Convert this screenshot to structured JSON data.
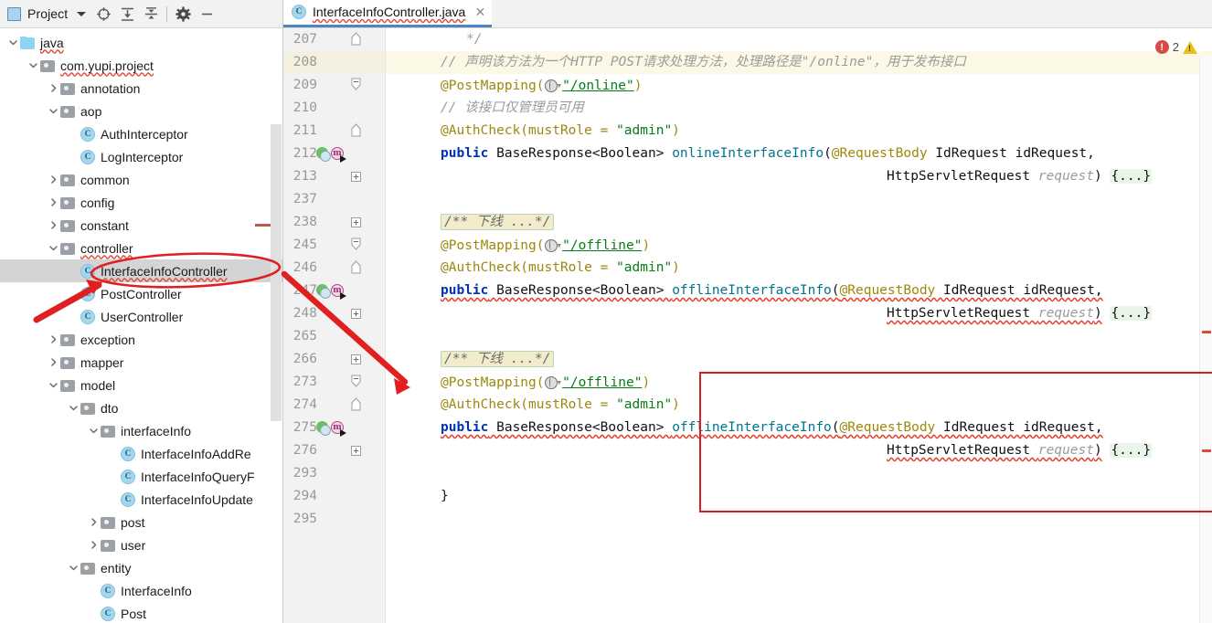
{
  "window": {
    "app": "IntelliJ IDEA",
    "panel_title": "Project"
  },
  "sidebar": {
    "toolbar": {
      "panel_icon": "project-panel-icon",
      "title": "Project",
      "dropdown_caret": "chevron-down-icon",
      "buttons": [
        {
          "name": "locate-icon",
          "tooltip": "Select Opened File"
        },
        {
          "name": "expand-all-icon",
          "tooltip": "Expand All"
        },
        {
          "name": "collapse-all-icon",
          "tooltip": "Collapse All"
        },
        {
          "name": "settings-gear-icon",
          "tooltip": "Settings"
        },
        {
          "name": "minimize-icon",
          "tooltip": "Hide"
        }
      ]
    },
    "tree": [
      {
        "label": "java",
        "type": "source-folder",
        "depth": 0,
        "state": "expanded",
        "squiggly": true
      },
      {
        "label": "com.yupi.project",
        "type": "package",
        "depth": 1,
        "state": "expanded",
        "squiggly": true
      },
      {
        "label": "annotation",
        "type": "package",
        "depth": 2,
        "state": "collapsed",
        "squiggly": false
      },
      {
        "label": "aop",
        "type": "package",
        "depth": 2,
        "state": "expanded",
        "squiggly": false
      },
      {
        "label": "AuthInterceptor",
        "type": "class",
        "depth": 3,
        "state": "leaf",
        "squiggly": false
      },
      {
        "label": "LogInterceptor",
        "type": "class",
        "depth": 3,
        "state": "leaf",
        "squiggly": false
      },
      {
        "label": "common",
        "type": "package",
        "depth": 2,
        "state": "collapsed",
        "squiggly": false
      },
      {
        "label": "config",
        "type": "package",
        "depth": 2,
        "state": "collapsed",
        "squiggly": false
      },
      {
        "label": "constant",
        "type": "package",
        "depth": 2,
        "state": "collapsed",
        "squiggly": false
      },
      {
        "label": "controller",
        "type": "package",
        "depth": 2,
        "state": "expanded",
        "squiggly": true
      },
      {
        "label": "InterfaceInfoController",
        "type": "class",
        "depth": 3,
        "state": "leaf",
        "squiggly": true,
        "selected": true
      },
      {
        "label": "PostController",
        "type": "class",
        "depth": 3,
        "state": "leaf",
        "squiggly": false
      },
      {
        "label": "UserController",
        "type": "class",
        "depth": 3,
        "state": "leaf",
        "squiggly": false
      },
      {
        "label": "exception",
        "type": "package",
        "depth": 2,
        "state": "collapsed",
        "squiggly": false
      },
      {
        "label": "mapper",
        "type": "package",
        "depth": 2,
        "state": "collapsed",
        "squiggly": false
      },
      {
        "label": "model",
        "type": "package",
        "depth": 2,
        "state": "expanded",
        "squiggly": false
      },
      {
        "label": "dto",
        "type": "package",
        "depth": 3,
        "state": "expanded",
        "squiggly": false
      },
      {
        "label": "interfaceInfo",
        "type": "package",
        "depth": 4,
        "state": "expanded",
        "squiggly": false
      },
      {
        "label": "InterfaceInfoAddRe",
        "type": "class",
        "depth": 5,
        "state": "leaf",
        "squiggly": false
      },
      {
        "label": "InterfaceInfoQueryF",
        "type": "class",
        "depth": 5,
        "state": "leaf",
        "squiggly": false
      },
      {
        "label": "InterfaceInfoUpdate",
        "type": "class",
        "depth": 5,
        "state": "leaf",
        "squiggly": false
      },
      {
        "label": "post",
        "type": "package",
        "depth": 4,
        "state": "collapsed",
        "squiggly": false
      },
      {
        "label": "user",
        "type": "package",
        "depth": 4,
        "state": "collapsed",
        "squiggly": false
      },
      {
        "label": "entity",
        "type": "package",
        "depth": 3,
        "state": "expanded",
        "squiggly": false
      },
      {
        "label": "InterfaceInfo",
        "type": "class",
        "depth": 4,
        "state": "leaf",
        "squiggly": false
      },
      {
        "label": "Post",
        "type": "class",
        "depth": 4,
        "state": "leaf",
        "squiggly": false
      }
    ]
  },
  "editor": {
    "tab": {
      "label": "InterfaceInfoController.java",
      "icon": "java-class-icon",
      "close": "✕"
    },
    "inspection": {
      "error_icon": "error-circle-icon",
      "error_count": "2",
      "warning_icon": "warning-triangle-icon"
    },
    "lines": [
      {
        "n": "207",
        "fold": "end",
        "gutter": null,
        "highlight": false,
        "tokens": [
          {
            "t": "cmt_block_end",
            "s": "*/"
          }
        ]
      },
      {
        "n": "208",
        "fold": null,
        "gutter": null,
        "highlight": true,
        "tokens": [
          {
            "t": "cmt",
            "s": "// 声明该方法为一个HTTP POST请求处理方法，处理路径是\"/online\"，用于发布接口"
          }
        ]
      },
      {
        "n": "209",
        "fold": "start",
        "gutter": null,
        "highlight": false,
        "anno": "@PostMapping(",
        "path": "\"/online\"",
        "tail": ")"
      },
      {
        "n": "210",
        "fold": null,
        "gutter": null,
        "highlight": false,
        "tokens": [
          {
            "t": "cmt",
            "s": "// 该接口仅管理员可用"
          }
        ]
      },
      {
        "n": "211",
        "fold": "mid",
        "gutter": null,
        "highlight": false,
        "authcheck": "@AuthCheck(mustRole = ",
        "role": "\"admin\"",
        "tail": ")"
      },
      {
        "n": "212",
        "fold": null,
        "gutter": [
          "web-service-icon",
          "method-override-icon"
        ],
        "highlight": false,
        "sig": "public BaseResponse<Boolean> onlineInterfaceInfo(@RequestBody IdRequest idRequest,"
      },
      {
        "n": "213",
        "fold": "plus",
        "gutter": null,
        "highlight": false,
        "sig2": "HttpServletRequest request) {...}"
      },
      {
        "n": "237",
        "fold": null,
        "gutter": null,
        "highlight": false,
        "tokens": []
      },
      {
        "n": "238",
        "fold": "plus",
        "gutter": null,
        "highlight": false,
        "folded_comment": "/** 下线 ...*/"
      },
      {
        "n": "245",
        "fold": "start",
        "gutter": null,
        "highlight": false,
        "anno": "@PostMapping(",
        "path": "\"/offline\"",
        "tail": ")"
      },
      {
        "n": "246",
        "fold": "mid",
        "gutter": null,
        "highlight": false,
        "authcheck": "@AuthCheck(mustRole = ",
        "role": "\"admin\"",
        "tail": ")"
      },
      {
        "n": "247",
        "fold": null,
        "gutter": [
          "web-service-icon",
          "method-override-icon"
        ],
        "highlight": false,
        "sig": "public BaseResponse<Boolean> offlineInterfaceInfo(@RequestBody IdRequest idRequest,",
        "error": true
      },
      {
        "n": "248",
        "fold": "plus",
        "gutter": null,
        "highlight": false,
        "sig2": "HttpServletRequest request) {...}",
        "error": true
      },
      {
        "n": "265",
        "fold": null,
        "gutter": null,
        "highlight": false,
        "tokens": []
      },
      {
        "n": "266",
        "fold": "plus",
        "gutter": null,
        "highlight": false,
        "folded_comment": "/** 下线 ...*/"
      },
      {
        "n": "273",
        "fold": "start",
        "gutter": null,
        "highlight": false,
        "anno": "@PostMapping(",
        "path": "\"/offline\"",
        "tail": ")"
      },
      {
        "n": "274",
        "fold": "mid",
        "gutter": null,
        "highlight": false,
        "authcheck": "@AuthCheck(mustRole = ",
        "role": "\"admin\"",
        "tail": ")"
      },
      {
        "n": "275",
        "fold": null,
        "gutter": [
          "web-service-icon",
          "method-override-icon"
        ],
        "highlight": false,
        "sig": "public BaseResponse<Boolean> offlineInterfaceInfo(@RequestBody IdRequest idRequest,",
        "error": true
      },
      {
        "n": "276",
        "fold": "plus",
        "gutter": null,
        "highlight": false,
        "sig2": "HttpServletRequest request) {...}",
        "error": true
      },
      {
        "n": "293",
        "fold": null,
        "gutter": null,
        "highlight": false,
        "tokens": []
      },
      {
        "n": "294",
        "fold": null,
        "gutter": null,
        "highlight": false,
        "tokens": [
          {
            "t": "plain",
            "s": "}"
          }
        ]
      },
      {
        "n": "295",
        "fold": null,
        "gutter": null,
        "highlight": false,
        "tokens": []
      }
    ],
    "code_text": {
      "close_comment": "*/",
      "comment_post_mapping": "// 声明该方法为一个HTTP POST请求处理方法，处理路径是\"/online\"，用于发布接口",
      "comment_admin_only": "// 该接口仅管理员可用",
      "post_mapping_head": "@PostMapping(",
      "path_online": "\"/online\"",
      "path_offline": "\"/offline\"",
      "close_paren": ")",
      "authcheck_head": "@AuthCheck(mustRole = ",
      "role_admin": "\"admin\"",
      "modifier_public": "public",
      "return_type": " BaseResponse<Boolean> ",
      "method_online": "onlineInterfaceInfo",
      "method_offline": "offlineInterfaceInfo",
      "param_anno": "@RequestBody",
      "param_id": " IdRequest idRequest,",
      "param_req_type": "HttpServletRequest ",
      "param_req_name": "request",
      "param_close": ")",
      "body_fold": "{...}",
      "folded_javadoc": "/** 下线 ...*/",
      "closing_brace": "}",
      "open_paren": "("
    }
  },
  "annotations": {
    "ellipse_color": "#e02020",
    "arrow_color": "#e02020",
    "box_color": "#d61f1f",
    "target_label": "InterfaceInfoController",
    "highlight_box_lines": [
      "266",
      "273",
      "274",
      "275",
      "276"
    ]
  }
}
